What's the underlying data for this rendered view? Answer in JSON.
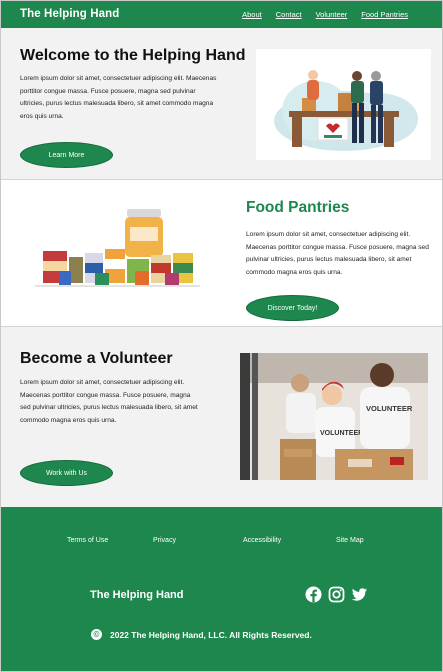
{
  "header": {
    "brand": "The Helping Hand",
    "nav": [
      "About",
      "Contact",
      "Volunteer",
      "Food Pantries"
    ]
  },
  "welcome": {
    "title": "Welcome to the Helping Hand",
    "text": "Lorem ipsum dolor sit amet, consectetuer adipiscing elit. Maecenas porttitor congue massa. Fusce posuere, magna sed pulvinar ultricies, purus lectus malesuada libero, sit amet commodo magna eros quis urna.",
    "button": "Learn More"
  },
  "pantries": {
    "title": "Food Pantries",
    "text": "Lorem ipsum dolor sit amet, consectetuer adipiscing elit. Maecenas porttitor congue massa. Fusce posuere, magna sed pulvinar ultricies, purus lectus malesuada libero, sit amet commodo magna eros quis urna.",
    "button": "Discover Today!"
  },
  "volunteer": {
    "title": "Become a Volunteer",
    "text": "Lorem ipsum dolor sit amet, consectetuer adipiscing elit. Maecenas porttitor congue massa. Fusce posuere, magna sed pulvinar ultricies, purus lectus malesuada libero, sit amet commodo magna eros quis urna.",
    "button": "Work with Us",
    "shirt_text": "VOLUNTEER"
  },
  "footer": {
    "links": [
      "Terms of Use",
      "Privacy",
      "Accessibility",
      "Site Map"
    ],
    "brand": "The Helping Hand",
    "copyright": "2022 The Helping Hand, LLC. All Rights Reserved.",
    "social_icons": [
      "facebook-icon",
      "instagram-icon",
      "twitter-icon"
    ]
  },
  "colors": {
    "brand_green": "#1e874e",
    "section_gray": "#f2f2f2"
  }
}
